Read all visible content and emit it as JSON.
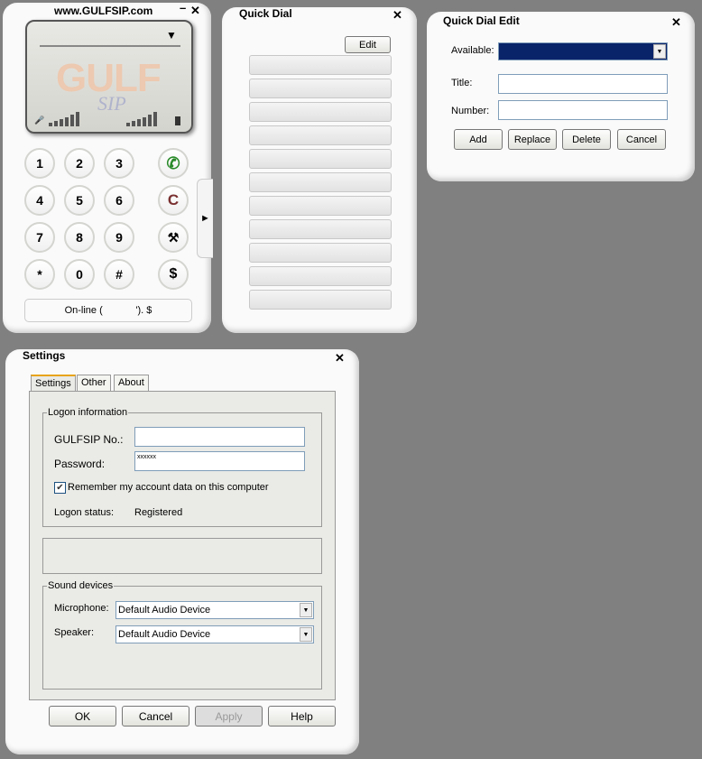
{
  "phone": {
    "title": "www.GULFSIP.com",
    "logo": "GULF SIP",
    "keys": [
      "1",
      "2",
      "3",
      "4",
      "5",
      "6",
      "7",
      "8",
      "9",
      "*",
      "0",
      "#"
    ],
    "clear": "C",
    "balance": "$",
    "status": "On-line (            '). $",
    "icons": {
      "call": "phone-icon",
      "settings": "tools-icon",
      "expand": "chevron-right-icon"
    }
  },
  "quick_dial": {
    "title": "Quick Dial",
    "edit": "Edit",
    "slots": 11
  },
  "quick_dial_edit": {
    "title": "Quick Dial Edit",
    "available_label": "Available:",
    "title_label": "Title:",
    "number_label": "Number:",
    "title_value": "",
    "number_value": "",
    "buttons": [
      "Add",
      "Replace",
      "Delete",
      "Cancel"
    ],
    "selection_color": "#0a246a"
  },
  "settings": {
    "title": "Settings",
    "tabs": [
      "Settings",
      "Other",
      "About"
    ],
    "logon_group": "Logon information",
    "no_label": "GULFSIP No.:",
    "no_value": "",
    "password_label": "Password:",
    "password_value": "xxxxxx",
    "remember_label": "Remember my account data on this computer",
    "remember_checked": true,
    "status_label": "Logon status:",
    "status_value": "Registered",
    "sound_group": "Sound devices",
    "mic_label": "Microphone:",
    "mic_value": "Default Audio Device",
    "speaker_label": "Speaker:",
    "speaker_value": "Default Audio Device",
    "buttons": {
      "ok": "OK",
      "cancel": "Cancel",
      "apply": "Apply",
      "help": "Help"
    }
  }
}
